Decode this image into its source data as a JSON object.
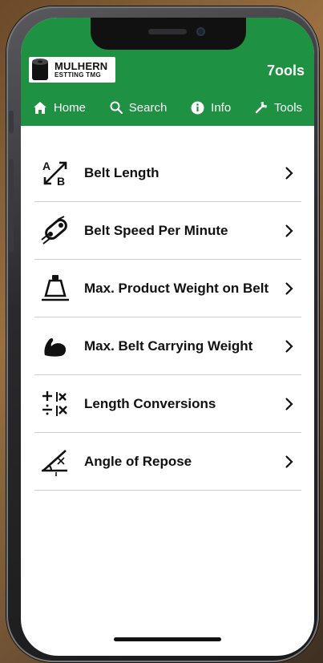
{
  "app": {
    "logo_name": "MULHERN",
    "logo_sub": "ESTTING TMG",
    "title": "7ools"
  },
  "nav": [
    {
      "label": "Home",
      "icon": "home-icon"
    },
    {
      "label": "Search",
      "icon": "search-icon"
    },
    {
      "label": "Info",
      "icon": "info-icon"
    },
    {
      "label": "Tools",
      "icon": "wrench-icon"
    }
  ],
  "tools": [
    {
      "label": "Belt Length",
      "icon": "belt-length-icon"
    },
    {
      "label": "Belt Speed Per Minute",
      "icon": "belt-speed-icon"
    },
    {
      "label": "Max. Product Weight on Belt",
      "icon": "weight-icon"
    },
    {
      "label": "Max. Belt Carrying Weight",
      "icon": "strength-icon"
    },
    {
      "label": "Length Conversions",
      "icon": "calculator-icon"
    },
    {
      "label": "Angle of Repose",
      "icon": "angle-icon"
    }
  ],
  "colors": {
    "header_green": "#1e9142",
    "text": "#111111",
    "divider": "#cfcfcf"
  }
}
